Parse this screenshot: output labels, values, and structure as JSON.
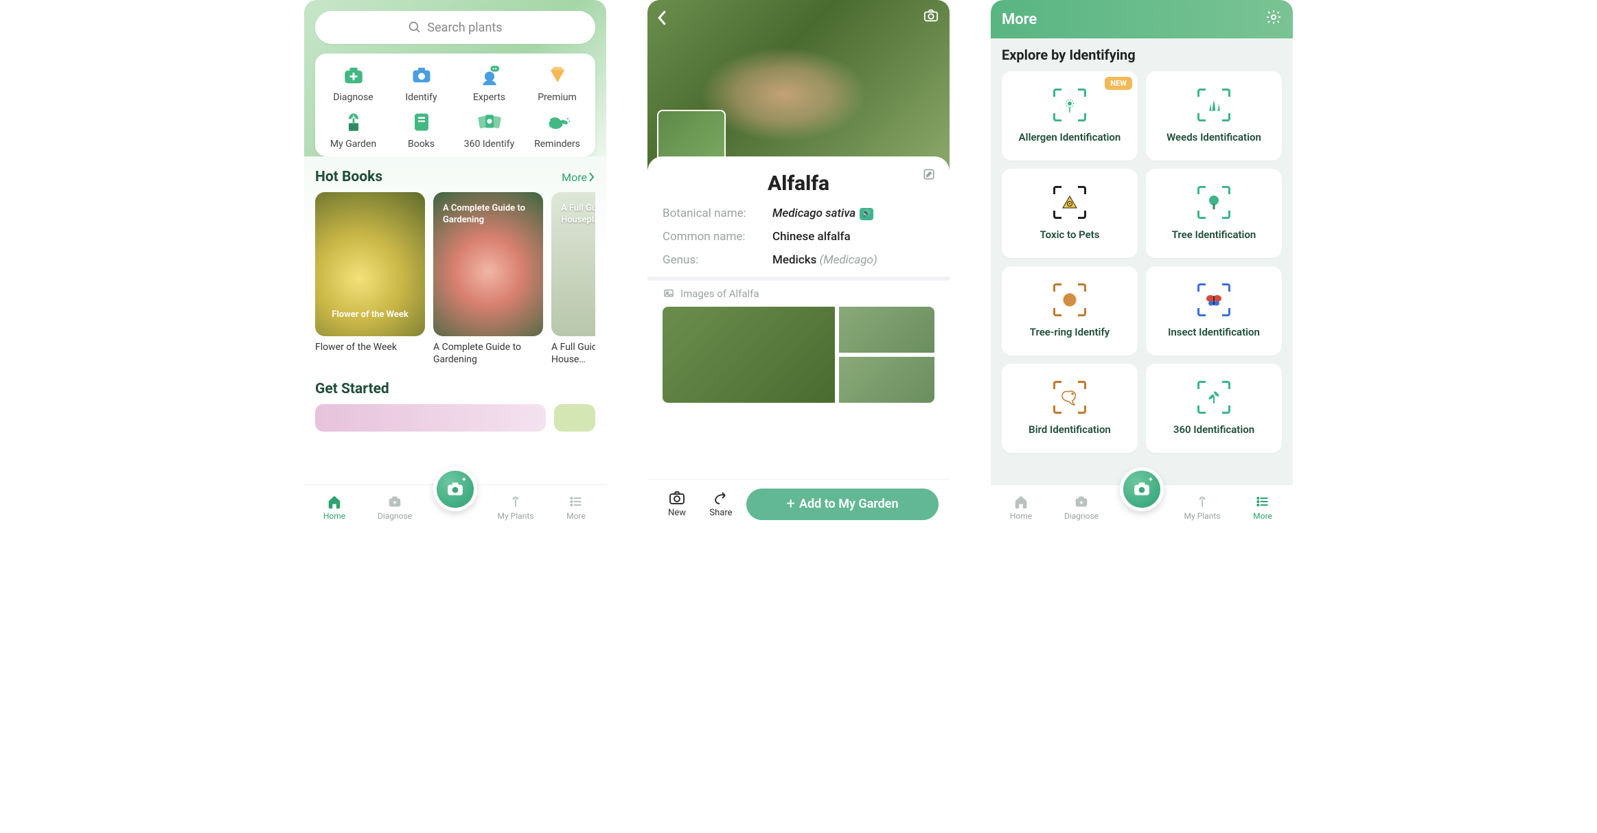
{
  "screen1": {
    "search_placeholder": "Search plants",
    "actions": [
      {
        "label": "Diagnose"
      },
      {
        "label": "Identify"
      },
      {
        "label": "Experts"
      },
      {
        "label": "Premium"
      },
      {
        "label": "My Garden"
      },
      {
        "label": "Books"
      },
      {
        "label": "360 Identify"
      },
      {
        "label": "Reminders"
      }
    ],
    "hot_books_title": "Hot Books",
    "more_label": "More",
    "books": [
      {
        "overlay": "Flower of the Week",
        "caption": "Flower of the Week"
      },
      {
        "overlay": "A Complete Guide to Gardening",
        "caption": "A Complete Guide to Gardening"
      },
      {
        "overlay": "A Full Guide to Popular Houseplants",
        "caption": "A Full Guide to Popular House…"
      }
    ],
    "get_started_title": "Get Started",
    "tabs": [
      "Home",
      "Diagnose",
      "My Plants",
      "More"
    ]
  },
  "screen2": {
    "title": "Alfalfa",
    "botanical_label": "Botanical name:",
    "botanical_value": "Medicago sativa",
    "common_label": "Common name:",
    "common_value": "Chinese alfalfa",
    "genus_label": "Genus:",
    "genus_value": "Medicks",
    "genus_sub": "(Medicago)",
    "images_of": "Images of Alfalfa",
    "new_label": "New",
    "share_label": "Share",
    "add_label": "Add to My Garden"
  },
  "screen3": {
    "header": "More",
    "section_title": "Explore by Identifying",
    "new_badge": "NEW",
    "cards": [
      {
        "label": "Allergen Identification",
        "has_badge": true
      },
      {
        "label": "Weeds Identification"
      },
      {
        "label": "Toxic to Pets"
      },
      {
        "label": "Tree Identification"
      },
      {
        "label": "Tree-ring Identify"
      },
      {
        "label": "Insect Identification"
      },
      {
        "label": "Bird Identification"
      },
      {
        "label": "360 Identification"
      }
    ],
    "tabs": [
      "Home",
      "Diagnose",
      "My Plants",
      "More"
    ]
  }
}
